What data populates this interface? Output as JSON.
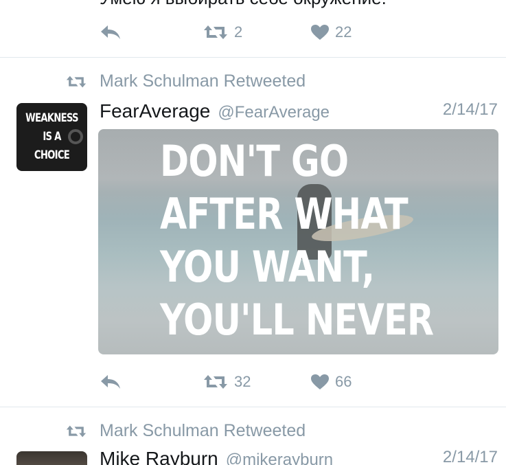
{
  "previous_tweet": {
    "text_fragment": "Умею я выбирать себе окружение.",
    "retweets": "2",
    "likes": "22"
  },
  "tweets": [
    {
      "retweeted_by": "Mark Schulman Retweeted",
      "name": "FearAverage",
      "handle": "@FearAverage",
      "date": "2/14/17",
      "avatar_text": [
        "WEAKNESS",
        "IS A",
        "CHOICE"
      ],
      "media_text": [
        "DON'T GO",
        "AFTER WHAT",
        "YOU WANT,",
        "YOU'LL NEVER"
      ],
      "retweets": "32",
      "likes": "66"
    },
    {
      "retweeted_by": "Mark Schulman Retweeted",
      "name": "Mike Rayburn",
      "handle": "@mikerayburn",
      "date": "2/14/17"
    }
  ],
  "icons": {
    "reply": "reply-icon",
    "retweet": "retweet-icon",
    "like": "heart-icon"
  },
  "colors": {
    "muted": "#8899a6",
    "text": "#14171a",
    "divider": "#e1e8ed"
  }
}
